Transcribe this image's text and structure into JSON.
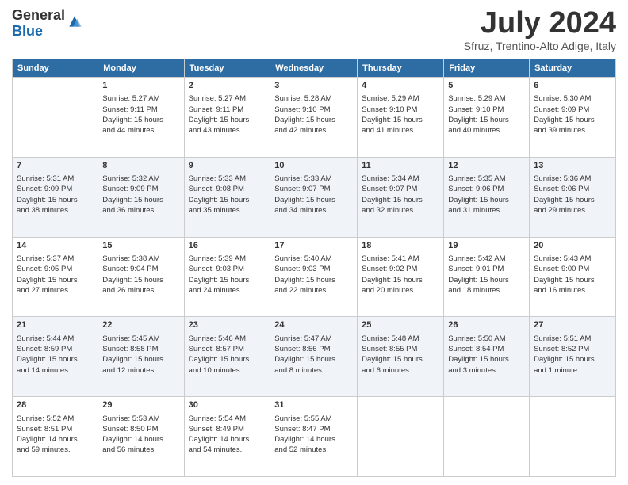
{
  "header": {
    "logo": {
      "general": "General",
      "blue": "Blue"
    },
    "title": "July 2024",
    "subtitle": "Sfruz, Trentino-Alto Adige, Italy"
  },
  "calendar": {
    "days": [
      "Sunday",
      "Monday",
      "Tuesday",
      "Wednesday",
      "Thursday",
      "Friday",
      "Saturday"
    ],
    "weeks": [
      [
        {
          "day": "",
          "info": ""
        },
        {
          "day": "1",
          "info": "Sunrise: 5:27 AM\nSunset: 9:11 PM\nDaylight: 15 hours\nand 44 minutes."
        },
        {
          "day": "2",
          "info": "Sunrise: 5:27 AM\nSunset: 9:11 PM\nDaylight: 15 hours\nand 43 minutes."
        },
        {
          "day": "3",
          "info": "Sunrise: 5:28 AM\nSunset: 9:10 PM\nDaylight: 15 hours\nand 42 minutes."
        },
        {
          "day": "4",
          "info": "Sunrise: 5:29 AM\nSunset: 9:10 PM\nDaylight: 15 hours\nand 41 minutes."
        },
        {
          "day": "5",
          "info": "Sunrise: 5:29 AM\nSunset: 9:10 PM\nDaylight: 15 hours\nand 40 minutes."
        },
        {
          "day": "6",
          "info": "Sunrise: 5:30 AM\nSunset: 9:09 PM\nDaylight: 15 hours\nand 39 minutes."
        }
      ],
      [
        {
          "day": "7",
          "info": "Sunrise: 5:31 AM\nSunset: 9:09 PM\nDaylight: 15 hours\nand 38 minutes."
        },
        {
          "day": "8",
          "info": "Sunrise: 5:32 AM\nSunset: 9:09 PM\nDaylight: 15 hours\nand 36 minutes."
        },
        {
          "day": "9",
          "info": "Sunrise: 5:33 AM\nSunset: 9:08 PM\nDaylight: 15 hours\nand 35 minutes."
        },
        {
          "day": "10",
          "info": "Sunrise: 5:33 AM\nSunset: 9:07 PM\nDaylight: 15 hours\nand 34 minutes."
        },
        {
          "day": "11",
          "info": "Sunrise: 5:34 AM\nSunset: 9:07 PM\nDaylight: 15 hours\nand 32 minutes."
        },
        {
          "day": "12",
          "info": "Sunrise: 5:35 AM\nSunset: 9:06 PM\nDaylight: 15 hours\nand 31 minutes."
        },
        {
          "day": "13",
          "info": "Sunrise: 5:36 AM\nSunset: 9:06 PM\nDaylight: 15 hours\nand 29 minutes."
        }
      ],
      [
        {
          "day": "14",
          "info": "Sunrise: 5:37 AM\nSunset: 9:05 PM\nDaylight: 15 hours\nand 27 minutes."
        },
        {
          "day": "15",
          "info": "Sunrise: 5:38 AM\nSunset: 9:04 PM\nDaylight: 15 hours\nand 26 minutes."
        },
        {
          "day": "16",
          "info": "Sunrise: 5:39 AM\nSunset: 9:03 PM\nDaylight: 15 hours\nand 24 minutes."
        },
        {
          "day": "17",
          "info": "Sunrise: 5:40 AM\nSunset: 9:03 PM\nDaylight: 15 hours\nand 22 minutes."
        },
        {
          "day": "18",
          "info": "Sunrise: 5:41 AM\nSunset: 9:02 PM\nDaylight: 15 hours\nand 20 minutes."
        },
        {
          "day": "19",
          "info": "Sunrise: 5:42 AM\nSunset: 9:01 PM\nDaylight: 15 hours\nand 18 minutes."
        },
        {
          "day": "20",
          "info": "Sunrise: 5:43 AM\nSunset: 9:00 PM\nDaylight: 15 hours\nand 16 minutes."
        }
      ],
      [
        {
          "day": "21",
          "info": "Sunrise: 5:44 AM\nSunset: 8:59 PM\nDaylight: 15 hours\nand 14 minutes."
        },
        {
          "day": "22",
          "info": "Sunrise: 5:45 AM\nSunset: 8:58 PM\nDaylight: 15 hours\nand 12 minutes."
        },
        {
          "day": "23",
          "info": "Sunrise: 5:46 AM\nSunset: 8:57 PM\nDaylight: 15 hours\nand 10 minutes."
        },
        {
          "day": "24",
          "info": "Sunrise: 5:47 AM\nSunset: 8:56 PM\nDaylight: 15 hours\nand 8 minutes."
        },
        {
          "day": "25",
          "info": "Sunrise: 5:48 AM\nSunset: 8:55 PM\nDaylight: 15 hours\nand 6 minutes."
        },
        {
          "day": "26",
          "info": "Sunrise: 5:50 AM\nSunset: 8:54 PM\nDaylight: 15 hours\nand 3 minutes."
        },
        {
          "day": "27",
          "info": "Sunrise: 5:51 AM\nSunset: 8:52 PM\nDaylight: 15 hours\nand 1 minute."
        }
      ],
      [
        {
          "day": "28",
          "info": "Sunrise: 5:52 AM\nSunset: 8:51 PM\nDaylight: 14 hours\nand 59 minutes."
        },
        {
          "day": "29",
          "info": "Sunrise: 5:53 AM\nSunset: 8:50 PM\nDaylight: 14 hours\nand 56 minutes."
        },
        {
          "day": "30",
          "info": "Sunrise: 5:54 AM\nSunset: 8:49 PM\nDaylight: 14 hours\nand 54 minutes."
        },
        {
          "day": "31",
          "info": "Sunrise: 5:55 AM\nSunset: 8:47 PM\nDaylight: 14 hours\nand 52 minutes."
        },
        {
          "day": "",
          "info": ""
        },
        {
          "day": "",
          "info": ""
        },
        {
          "day": "",
          "info": ""
        }
      ]
    ]
  }
}
